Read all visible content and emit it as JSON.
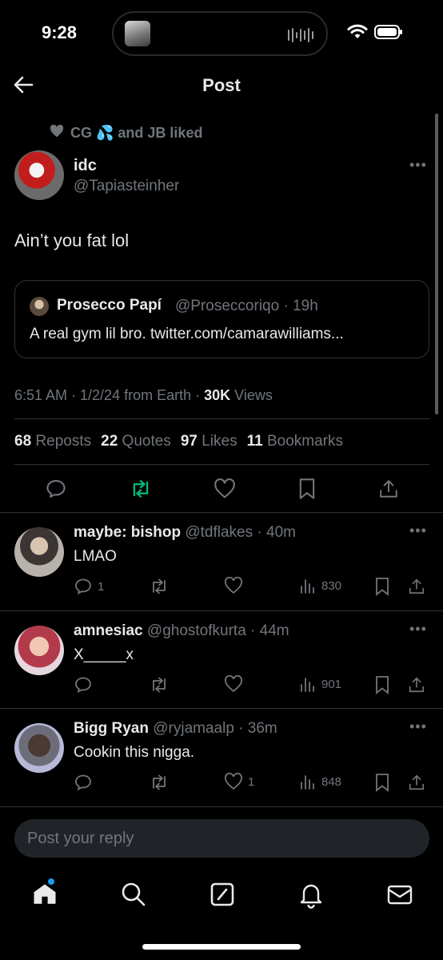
{
  "status_bar": {
    "time": "9:28"
  },
  "header": {
    "title": "Post"
  },
  "post": {
    "liked_by": "CG 💦 and JB liked",
    "author_name": "idc",
    "author_handle": "@Tapiasteinher",
    "text": "Ain’t you fat lol",
    "quote": {
      "name": "Prosecco Papí",
      "handle_time": "@Proseccoriqo · 19h",
      "text": "A real gym lil bro. twitter.com/camarawilliams..."
    },
    "meta_time": "6:51 AM · 1/2/24 from Earth · ",
    "meta_views_count": "30K",
    "meta_views_label": " Views",
    "stats": [
      {
        "count": "68",
        "label": "Reposts"
      },
      {
        "count": "22",
        "label": "Quotes"
      },
      {
        "count": "97",
        "label": "Likes"
      },
      {
        "count": "11",
        "label": "Bookmarks"
      }
    ]
  },
  "replies": [
    {
      "name": "maybe: bishop",
      "handle_time": "@tdflakes · 40m",
      "text": "LMAO",
      "reply_count": "1",
      "like_count": "",
      "views": "830"
    },
    {
      "name": "amnesiac",
      "handle_time": "@ghostofkurta · 44m",
      "text": "X_____x",
      "reply_count": "",
      "like_count": "",
      "views": "901"
    },
    {
      "name": "Bigg Ryan",
      "handle_time": "@ryjamaalp · 36m",
      "text": "Cookin this nigga.",
      "reply_count": "",
      "like_count": "1",
      "views": "848"
    }
  ],
  "reply_box": {
    "placeholder": "Post your reply"
  },
  "colors": {
    "accent": "#1d9bf0",
    "repost_active": "#00ba7c",
    "muted": "#71767b"
  }
}
